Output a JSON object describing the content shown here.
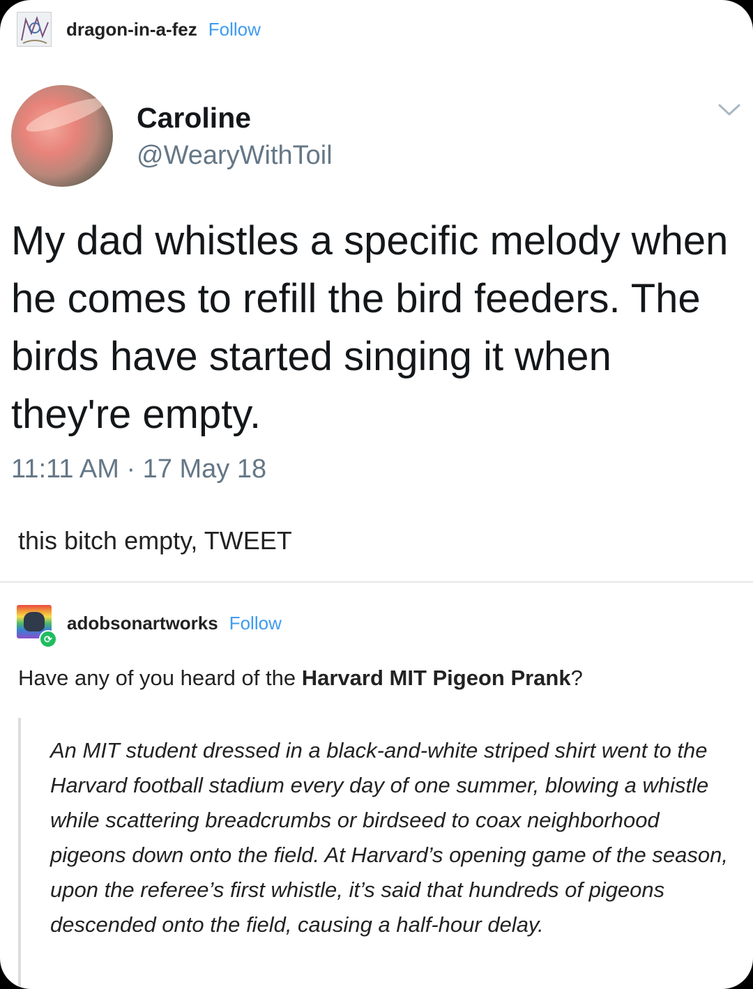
{
  "post1": {
    "username": "dragon-in-a-fez",
    "follow_label": "Follow"
  },
  "tweet": {
    "name": "Caroline",
    "handle": "@WearyWithToil",
    "text": "My dad whistles a specific melody when he comes to refill the bird feeders. The birds have started singing it when they're empty.",
    "timestamp": "11:11 AM · 17 May 18",
    "menu_icon": "chevron-down-icon"
  },
  "post1_comment": "this bitch empty, TWEET",
  "post2": {
    "username": "adobsonartworks",
    "follow_label": "Follow",
    "intro_prefix": "Have any of you heard of the ",
    "intro_bold": "Harvard MIT Pigeon Prank",
    "intro_suffix": "?",
    "quote": "An MIT student dressed in a black-and-white striped shirt went to the Harvard football stadium every day of one summer, blowing a whistle while scattering breadcrumbs or birdseed to coax neighborhood pigeons down onto the field. At Harvard’s opening game of the season, upon the referee’s first whistle, it’s said that hundreds of pigeons descended onto the field, causing a half-hour delay.",
    "badge_icon": "reblog-icon"
  },
  "colors": {
    "link_blue": "#3d9bf0",
    "twitter_gray": "#657786",
    "reblog_green": "#1fbd5f"
  }
}
